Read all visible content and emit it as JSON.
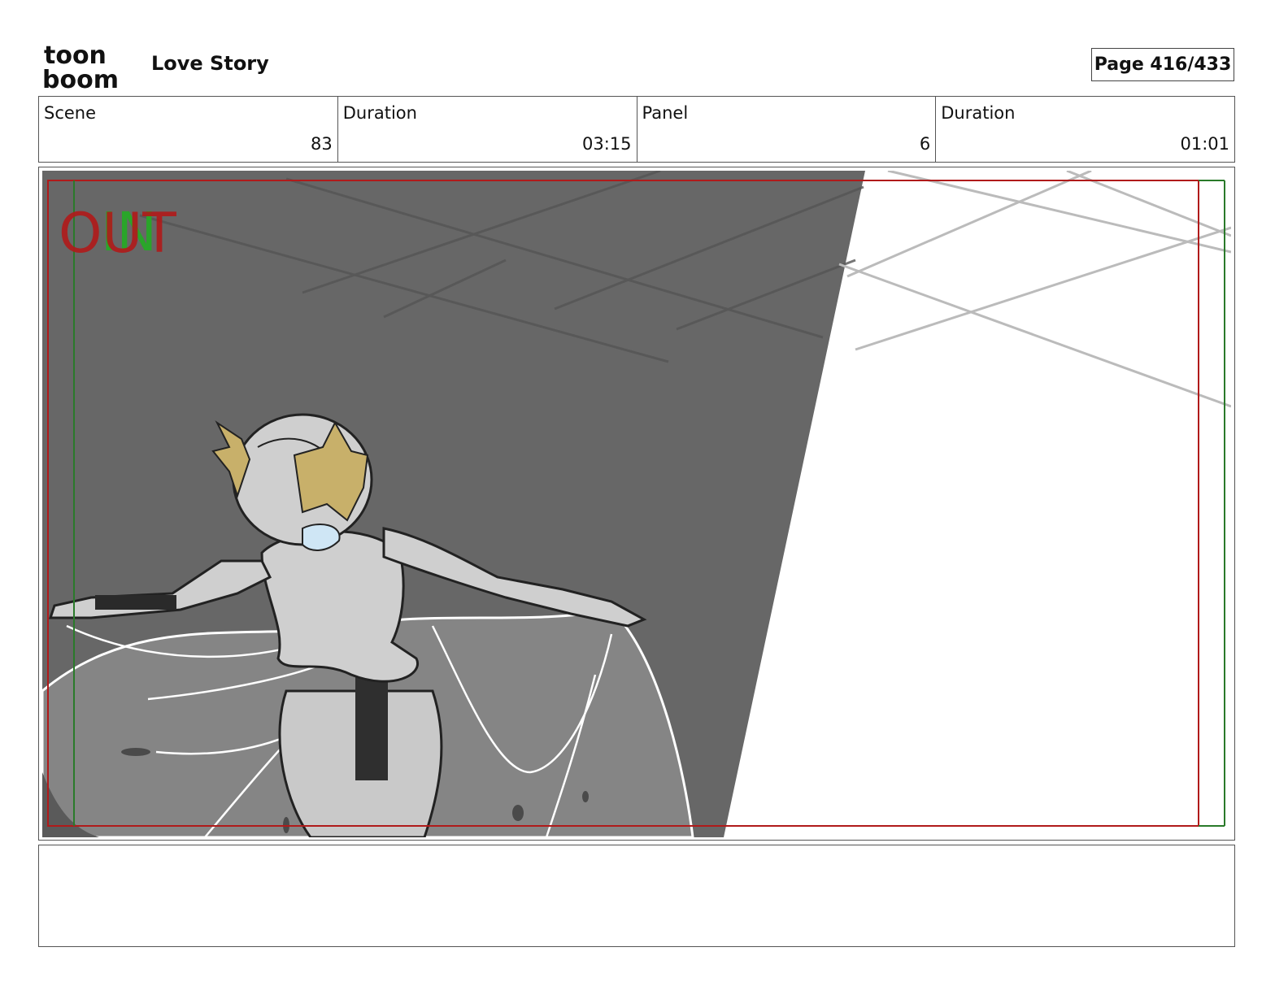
{
  "header": {
    "logo_text_top": "toon",
    "logo_text_bottom": "boom",
    "project_title": "Love Story",
    "page_label": "Page 416/433"
  },
  "info": [
    {
      "label": "Scene",
      "value": "83"
    },
    {
      "label": "Duration",
      "value": "03:15"
    },
    {
      "label": "Panel",
      "value": "6"
    },
    {
      "label": "Duration",
      "value": "01:01"
    }
  ],
  "panel": {
    "overlay_out": "OUT",
    "overlay_in": "IN",
    "colors": {
      "out_frame": "#b01a1a",
      "in_frame": "#2a7a2a",
      "shadow": "#676767",
      "hair": "#c8b06a",
      "visor": "#cfe6f5"
    }
  },
  "notes": {
    "text": ""
  }
}
